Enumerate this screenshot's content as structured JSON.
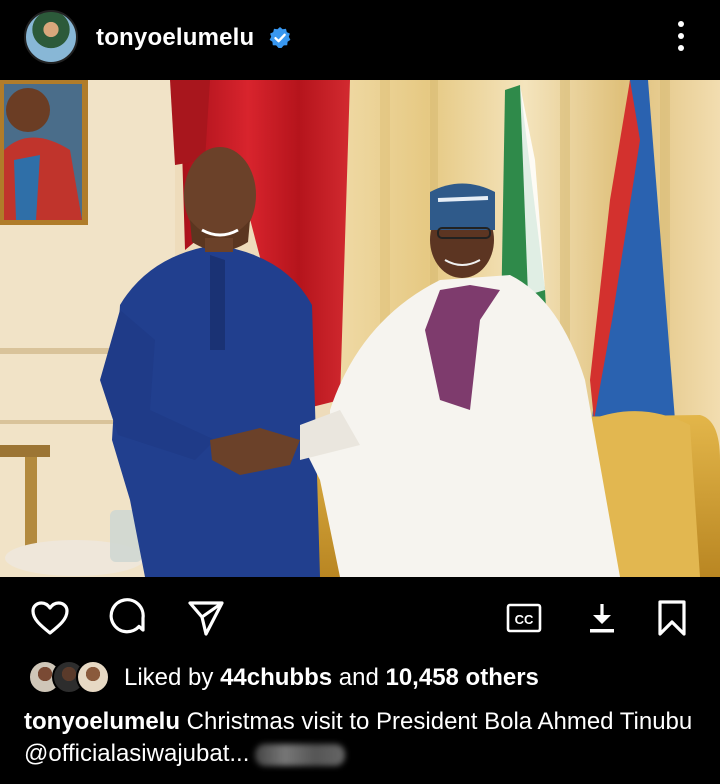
{
  "post": {
    "username": "tonyoelumelu",
    "verified": true,
    "more_icon": "more-vertical-icon"
  },
  "actions": {
    "like_icon": "heart-icon",
    "comment_icon": "comment-icon",
    "share_icon": "send-icon",
    "cc_label": "CC",
    "download_icon": "download-icon",
    "save_icon": "bookmark-icon"
  },
  "likes": {
    "prefix": "Liked by ",
    "user": "44chubbs",
    "middle": " and ",
    "count": "10,458 others"
  },
  "caption": {
    "username": "tonyoelumelu",
    "text": " Christmas visit to President Bola Ahmed Tinubu @officialasiwajubat..."
  },
  "colors": {
    "background": "#000000",
    "text": "#ffffff",
    "verified_badge": "#3897f0"
  }
}
